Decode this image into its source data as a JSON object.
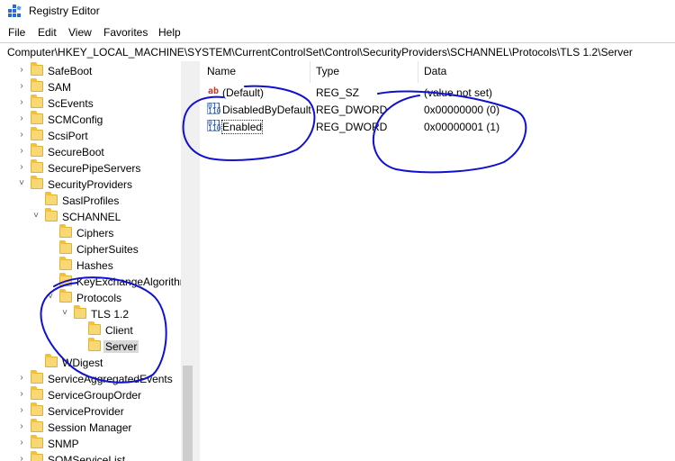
{
  "window": {
    "title": "Registry Editor"
  },
  "menu": {
    "items": [
      "File",
      "Edit",
      "View",
      "Favorites",
      "Help"
    ]
  },
  "address": {
    "path": "Computer\\HKEY_LOCAL_MACHINE\\SYSTEM\\CurrentControlSet\\Control\\SecurityProviders\\SCHANNEL\\Protocols\\TLS 1.2\\Server"
  },
  "tree": {
    "items": [
      {
        "label": "SafeBoot",
        "depth": 0,
        "toggle": ">"
      },
      {
        "label": "SAM",
        "depth": 0,
        "toggle": ">"
      },
      {
        "label": "ScEvents",
        "depth": 0,
        "toggle": ">"
      },
      {
        "label": "SCMConfig",
        "depth": 0,
        "toggle": ">"
      },
      {
        "label": "ScsiPort",
        "depth": 0,
        "toggle": ">"
      },
      {
        "label": "SecureBoot",
        "depth": 0,
        "toggle": ">"
      },
      {
        "label": "SecurePipeServers",
        "depth": 0,
        "toggle": ">"
      },
      {
        "label": "SecurityProviders",
        "depth": 0,
        "toggle": "v"
      },
      {
        "label": "SaslProfiles",
        "depth": 1,
        "toggle": ""
      },
      {
        "label": "SCHANNEL",
        "depth": 1,
        "toggle": "v"
      },
      {
        "label": "Ciphers",
        "depth": 2,
        "toggle": ""
      },
      {
        "label": "CipherSuites",
        "depth": 2,
        "toggle": ""
      },
      {
        "label": "Hashes",
        "depth": 2,
        "toggle": ""
      },
      {
        "label": "KeyExchangeAlgorithms",
        "depth": 2,
        "toggle": ""
      },
      {
        "label": "Protocols",
        "depth": 2,
        "toggle": "v"
      },
      {
        "label": "TLS 1.2",
        "depth": 3,
        "toggle": "v"
      },
      {
        "label": "Client",
        "depth": 4,
        "toggle": ""
      },
      {
        "label": "Server",
        "depth": 4,
        "toggle": "",
        "selected": true
      },
      {
        "label": "WDigest",
        "depth": 1,
        "toggle": ""
      },
      {
        "label": "ServiceAggregatedEvents",
        "depth": 0,
        "toggle": ">"
      },
      {
        "label": "ServiceGroupOrder",
        "depth": 0,
        "toggle": ">"
      },
      {
        "label": "ServiceProvider",
        "depth": 0,
        "toggle": ">"
      },
      {
        "label": "Session Manager",
        "depth": 0,
        "toggle": ">"
      },
      {
        "label": "SNMP",
        "depth": 0,
        "toggle": ">"
      },
      {
        "label": "SQMServiceList",
        "depth": 0,
        "toggle": ">"
      }
    ]
  },
  "values": {
    "columns": [
      "Name",
      "Type",
      "Data"
    ],
    "rows": [
      {
        "icon": "string-value-icon",
        "name": "(Default)",
        "type": "REG_SZ",
        "data": "(value not set)"
      },
      {
        "icon": "dword-value-icon",
        "name": "DisabledByDefault",
        "type": "REG_DWORD",
        "data": "0x00000000 (0)"
      },
      {
        "icon": "dword-value-icon",
        "name": "Enabled",
        "type": "REG_DWORD",
        "data": "0x00000001 (1)",
        "focused": true
      }
    ]
  },
  "colors": {
    "folder": "#f8d775",
    "annotation_ink": "#1010d0",
    "selection": "#d9d9d9"
  }
}
